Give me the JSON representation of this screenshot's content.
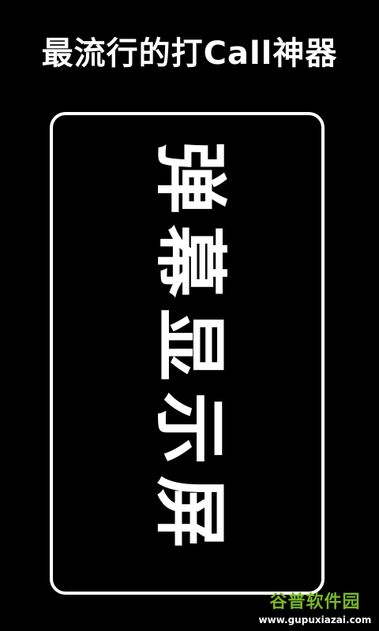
{
  "header": {
    "title": "最流行的打Call神器"
  },
  "display": {
    "text": "弹幕显示屏"
  },
  "watermark": {
    "title": "谷普软件园",
    "url": "www.gupuxiazai.com",
    "color": "#7ab828"
  }
}
